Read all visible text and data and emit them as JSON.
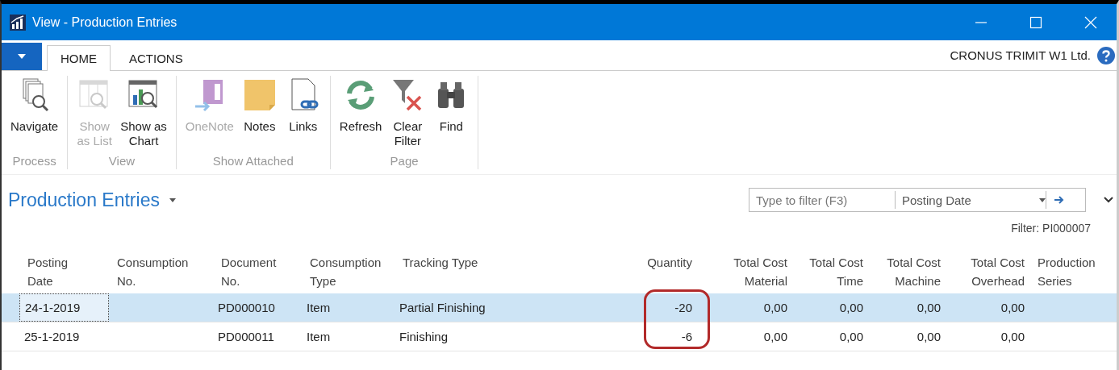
{
  "window": {
    "title": "View - Production Entries"
  },
  "ribbon_tabs": [
    {
      "label": "HOME",
      "selected": true
    },
    {
      "label": "ACTIONS",
      "selected": false
    }
  ],
  "company": "CRONUS TRIMIT W1 Ltd.",
  "ribbon_groups": [
    {
      "label": "Process",
      "buttons": [
        {
          "label": "Navigate",
          "disabled": false
        }
      ]
    },
    {
      "label": "View",
      "buttons": [
        {
          "label": "Show\nas List",
          "disabled": true
        },
        {
          "label": "Show as\nChart",
          "disabled": false
        }
      ]
    },
    {
      "label": "Show Attached",
      "buttons": [
        {
          "label": "OneNote",
          "disabled": true
        },
        {
          "label": "Notes",
          "disabled": false
        },
        {
          "label": "Links",
          "disabled": false
        }
      ]
    },
    {
      "label": "Page",
      "buttons": [
        {
          "label": "Refresh",
          "disabled": false
        },
        {
          "label": "Clear\nFilter",
          "disabled": false
        },
        {
          "label": "Find",
          "disabled": false
        }
      ]
    }
  ],
  "page": {
    "title": "Production Entries"
  },
  "filter": {
    "placeholder": "Type to filter (F3)",
    "field": "Posting Date",
    "caption": "Filter: PI000007"
  },
  "table": {
    "columns": [
      {
        "label": "Posting\nDate",
        "numeric": false
      },
      {
        "label": "Consumption\nNo.",
        "numeric": false
      },
      {
        "label": "Document\nNo.",
        "numeric": false
      },
      {
        "label": "Consumption\nType",
        "numeric": false
      },
      {
        "label": "Tracking Type",
        "numeric": false
      },
      {
        "label": "Quantity",
        "numeric": true,
        "highlighted": true
      },
      {
        "label": "Total Cost\nMaterial",
        "numeric": true
      },
      {
        "label": "Total Cost\nTime",
        "numeric": true
      },
      {
        "label": "Total Cost\nMachine",
        "numeric": true
      },
      {
        "label": "Total Cost\nOverhead",
        "numeric": true
      },
      {
        "label": "Production\nSeries",
        "numeric": false
      }
    ],
    "rows": [
      {
        "selected": true,
        "cells": [
          "24-1-2019",
          null,
          "PD000010",
          "Item",
          "Partial Finishing",
          "-20",
          "0,00",
          "0,00",
          "0,00",
          "0,00",
          null
        ]
      },
      {
        "selected": false,
        "cells": [
          "25-1-2019",
          null,
          "PD000011",
          "Item",
          "Finishing",
          "-6",
          "0,00",
          "0,00",
          "0,00",
          "0,00",
          null
        ]
      }
    ]
  }
}
